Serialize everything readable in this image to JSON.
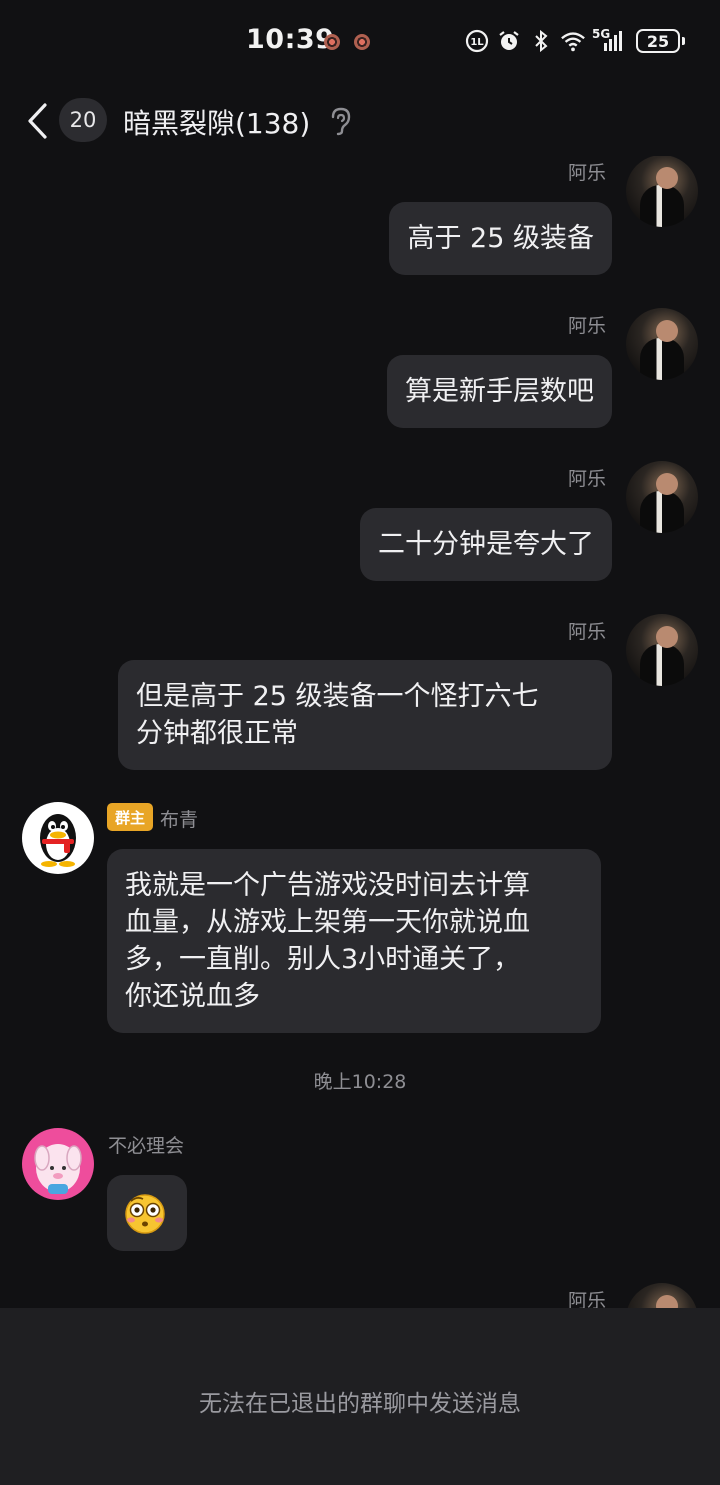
{
  "status_bar": {
    "time": "10:39",
    "battery": "25",
    "network": "5G"
  },
  "header": {
    "unread_count": "20",
    "title": "暗黑裂隙(138)"
  },
  "messages": [
    {
      "sender": "阿乐",
      "side": "right",
      "text": "高于 25 级装备"
    },
    {
      "sender": "阿乐",
      "side": "right",
      "text": "算是新手层数吧"
    },
    {
      "sender": "阿乐",
      "side": "right",
      "text": "二十分钟是夸大了"
    },
    {
      "sender": "阿乐",
      "side": "right",
      "text": "但是高于 25 级装备一个怪打六七\n分钟都很正常"
    },
    {
      "sender": "布青",
      "side": "left",
      "role_tag": "群主",
      "text": "我就是一个广告游戏没时间去计算\n血量，从游戏上架第一天你就说血\n多，一直削。别人3小时通关了，\n你还说血多"
    },
    {
      "sender": "不必理会",
      "side": "left",
      "text": "",
      "emoji": "flushed-face"
    },
    {
      "sender": "阿乐",
      "side": "right",
      "text": ""
    }
  ],
  "time_divider": "晚上10:28",
  "bottom_notice": "无法在已退出的群聊中发送消息",
  "colors": {
    "background": "#111113",
    "bubble": "#2b2b2f",
    "owner_tag": "#e8a526",
    "bottom_bar": "#1f1f22"
  }
}
